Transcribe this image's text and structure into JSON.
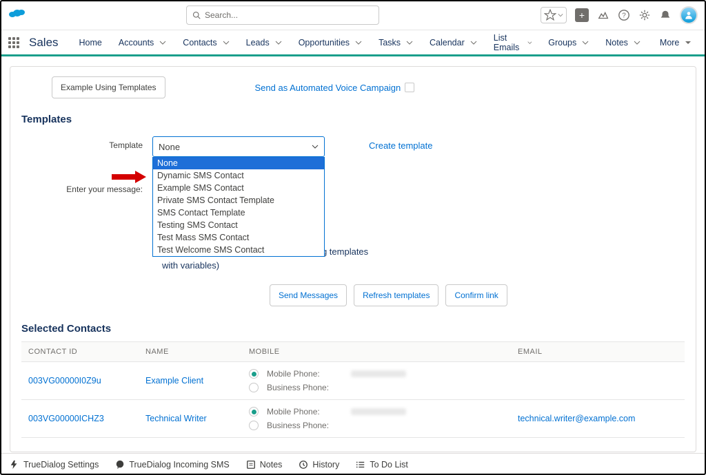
{
  "header": {
    "search_placeholder": "Search..."
  },
  "nav": {
    "app": "Sales",
    "items": [
      "Home",
      "Accounts",
      "Contacts",
      "Leads",
      "Opportunities",
      "Tasks",
      "Calendar",
      "List Emails",
      "Groups",
      "Notes",
      "More"
    ]
  },
  "topbar": {
    "example_btn": "Example Using Templates",
    "auto_label": "Send as Automated Voice Campaign"
  },
  "templates": {
    "title": "Templates",
    "label": "Template",
    "selected": "None",
    "options": [
      "None",
      "Dynamic SMS Contact",
      "Example SMS Contact",
      "Private SMS Contact Template",
      "SMS Contact Template",
      "Testing SMS Contact",
      "Test Mass SMS Contact",
      "Test Welcome SMS Contact"
    ],
    "create_link": "Create template",
    "message_label": "Enter your message:",
    "calc_note": "(calculations are approximate when using templates with variables)",
    "btn_send": "Send Messages",
    "btn_refresh": "Refresh templates",
    "btn_confirm": "Confirm link"
  },
  "contacts": {
    "title": "Selected Contacts",
    "headers": {
      "id": "CONTACT ID",
      "name": "NAME",
      "mobile": "MOBILE",
      "email": "EMAIL"
    },
    "rows": [
      {
        "id": "003VG00000I0Z9u",
        "name": "Example Client",
        "mobile_label": "Mobile Phone:",
        "biz_label": "Business Phone:",
        "email": ""
      },
      {
        "id": "003VG00000ICHZ3",
        "name": "Technical Writer",
        "mobile_label": "Mobile Phone:",
        "biz_label": "Business Phone:",
        "email": "technical.writer@example.com"
      }
    ]
  },
  "footer": {
    "items": [
      "TrueDialog Settings",
      "TrueDialog Incoming SMS",
      "Notes",
      "History",
      "To Do List"
    ]
  }
}
